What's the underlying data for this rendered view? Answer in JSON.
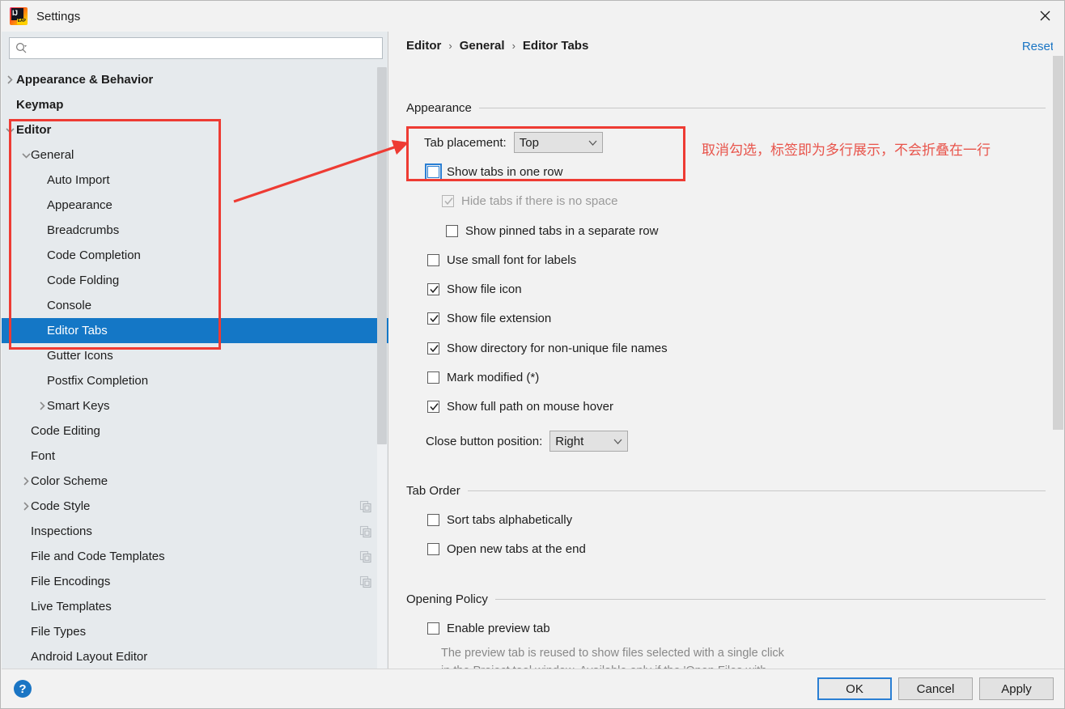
{
  "window": {
    "title": "Settings",
    "logo_icon": "intellij-idea-eap-logo",
    "close_icon": "close-icon"
  },
  "sidebar": {
    "search": {
      "placeholder": "",
      "value": "",
      "icon": "search-icon"
    },
    "items": [
      {
        "label": "Appearance & Behavior",
        "depth": 0,
        "arrow": "chevron-right",
        "bold": true,
        "selected": false,
        "copy": false
      },
      {
        "label": "Keymap",
        "depth": 0,
        "arrow": "none",
        "bold": true,
        "selected": false,
        "copy": false
      },
      {
        "label": "Editor",
        "depth": 0,
        "arrow": "chevron-down",
        "bold": true,
        "selected": false,
        "copy": false
      },
      {
        "label": "General",
        "depth": 1,
        "arrow": "chevron-down",
        "bold": false,
        "selected": false,
        "copy": false
      },
      {
        "label": "Auto Import",
        "depth": 2,
        "arrow": "none",
        "bold": false,
        "selected": false,
        "copy": false
      },
      {
        "label": "Appearance",
        "depth": 2,
        "arrow": "none",
        "bold": false,
        "selected": false,
        "copy": false
      },
      {
        "label": "Breadcrumbs",
        "depth": 2,
        "arrow": "none",
        "bold": false,
        "selected": false,
        "copy": false
      },
      {
        "label": "Code Completion",
        "depth": 2,
        "arrow": "none",
        "bold": false,
        "selected": false,
        "copy": false
      },
      {
        "label": "Code Folding",
        "depth": 2,
        "arrow": "none",
        "bold": false,
        "selected": false,
        "copy": false
      },
      {
        "label": "Console",
        "depth": 2,
        "arrow": "none",
        "bold": false,
        "selected": false,
        "copy": false
      },
      {
        "label": "Editor Tabs",
        "depth": 2,
        "arrow": "none",
        "bold": false,
        "selected": true,
        "copy": false
      },
      {
        "label": "Gutter Icons",
        "depth": 2,
        "arrow": "none",
        "bold": false,
        "selected": false,
        "copy": false
      },
      {
        "label": "Postfix Completion",
        "depth": 2,
        "arrow": "none",
        "bold": false,
        "selected": false,
        "copy": false
      },
      {
        "label": "Smart Keys",
        "depth": 2,
        "arrow": "chevron-right",
        "bold": false,
        "selected": false,
        "copy": false
      },
      {
        "label": "Code Editing",
        "depth": 1,
        "arrow": "none",
        "bold": false,
        "selected": false,
        "copy": false
      },
      {
        "label": "Font",
        "depth": 1,
        "arrow": "none",
        "bold": false,
        "selected": false,
        "copy": false
      },
      {
        "label": "Color Scheme",
        "depth": 1,
        "arrow": "chevron-right",
        "bold": false,
        "selected": false,
        "copy": false
      },
      {
        "label": "Code Style",
        "depth": 1,
        "arrow": "chevron-right",
        "bold": false,
        "selected": false,
        "copy": true
      },
      {
        "label": "Inspections",
        "depth": 1,
        "arrow": "none",
        "bold": false,
        "selected": false,
        "copy": true
      },
      {
        "label": "File and Code Templates",
        "depth": 1,
        "arrow": "none",
        "bold": false,
        "selected": false,
        "copy": true
      },
      {
        "label": "File Encodings",
        "depth": 1,
        "arrow": "none",
        "bold": false,
        "selected": false,
        "copy": true
      },
      {
        "label": "Live Templates",
        "depth": 1,
        "arrow": "none",
        "bold": false,
        "selected": false,
        "copy": false
      },
      {
        "label": "File Types",
        "depth": 1,
        "arrow": "none",
        "bold": false,
        "selected": false,
        "copy": false
      },
      {
        "label": "Android Layout Editor",
        "depth": 1,
        "arrow": "none",
        "bold": false,
        "selected": false,
        "copy": false
      }
    ]
  },
  "main": {
    "breadcrumb": {
      "part1": "Editor",
      "part2": "General",
      "part3": "Editor Tabs",
      "separator": "›"
    },
    "reset_label": "Reset",
    "sections": {
      "appearance": {
        "title": "Appearance",
        "tab_placement_label": "Tab placement:",
        "tab_placement_value": "Top",
        "show_tabs_one_row": "Show tabs in one row",
        "hide_tabs_no_space": "Hide tabs if there is no space",
        "show_pinned_separate_row": "Show pinned tabs in a separate row",
        "use_small_font": "Use small font for labels",
        "show_file_icon": "Show file icon",
        "show_file_extension": "Show file extension",
        "show_directory_nonunique": "Show directory for non-unique file names",
        "mark_modified": "Mark modified (*)",
        "show_full_path_hover": "Show full path on mouse hover",
        "close_button_label": "Close button position:",
        "close_button_value": "Right"
      },
      "tab_order": {
        "title": "Tab Order",
        "sort_alphabetically": "Sort tabs alphabetically",
        "open_new_at_end": "Open new tabs at the end"
      },
      "opening_policy": {
        "title": "Opening Policy",
        "enable_preview_tab": "Enable preview tab",
        "description": "The preview tab is reused to show files selected with a single click\nin the Project tool window. Available only if the 'Open Files with\nSingle Click' option is on."
      }
    }
  },
  "footer": {
    "help_label": "?",
    "ok_label": "OK",
    "cancel_label": "Cancel",
    "apply_label": "Apply"
  },
  "annotations": {
    "note_text": "取消勾选，标签即为多行展示，不会折叠在一行",
    "accent_color": "#ee3b33"
  },
  "colors": {
    "sidebar_bg": "#e6eaed",
    "main_bg": "#f2f2f2",
    "selection_blue": "#1477c6",
    "link_blue": "#1a75c4",
    "annotation_red": "#ee3b33"
  }
}
